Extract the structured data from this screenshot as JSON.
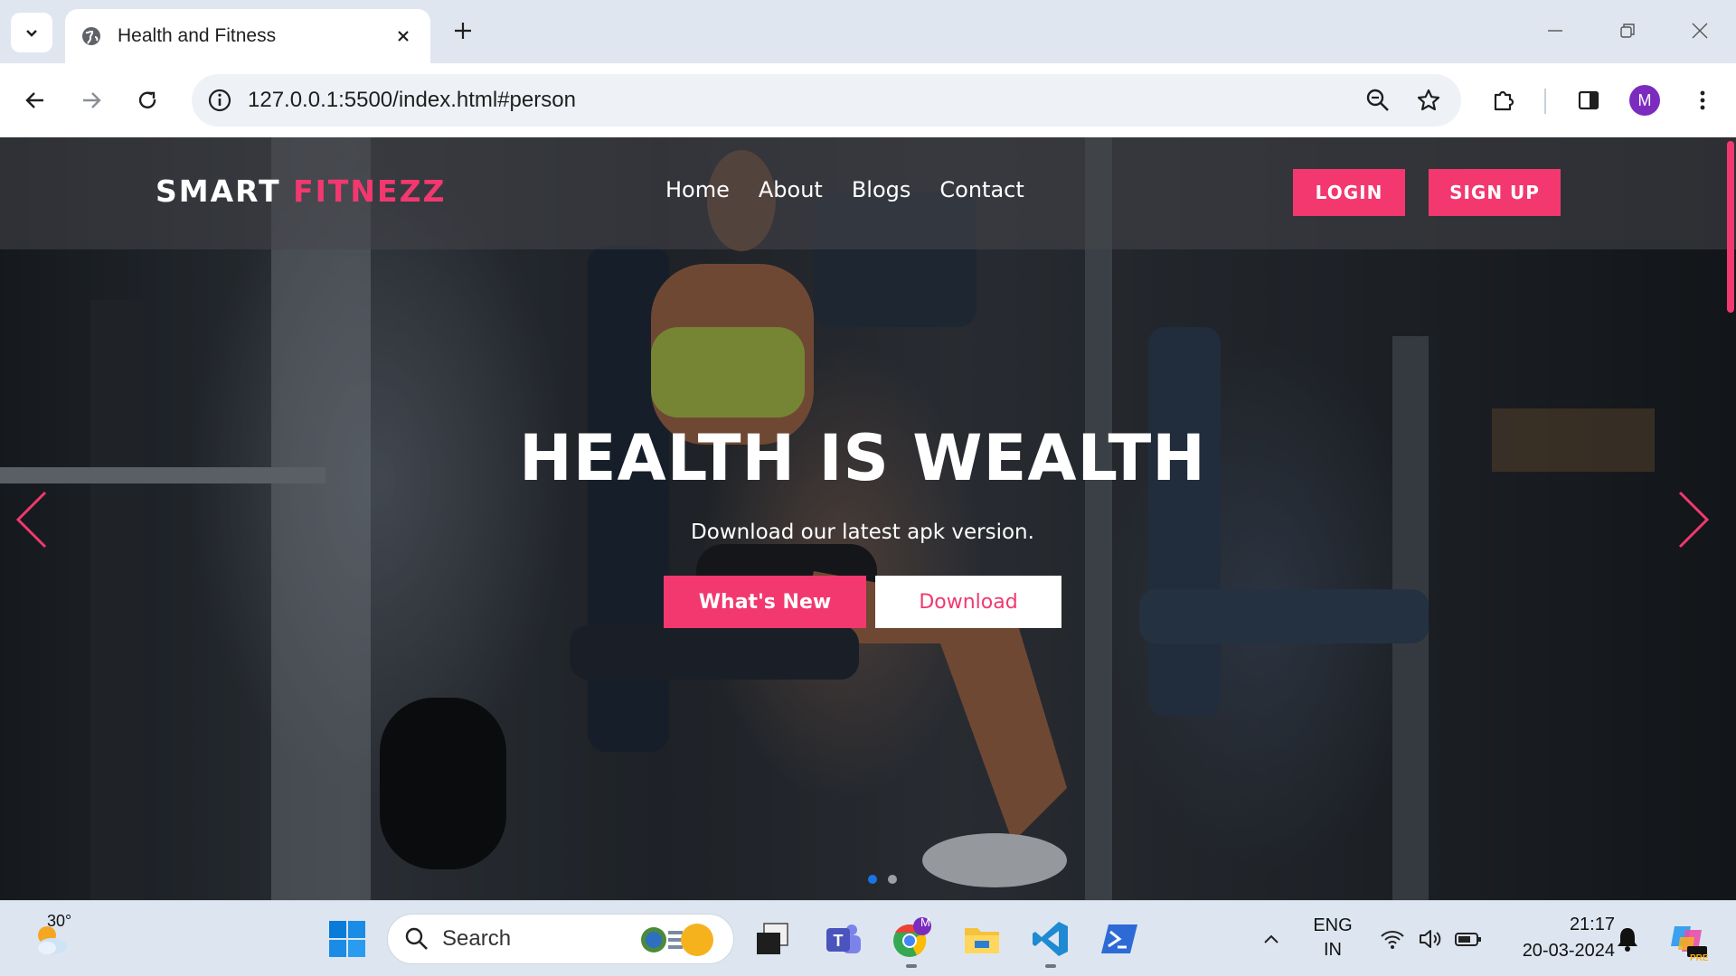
{
  "browser": {
    "tab_title": "Health and Fitness",
    "url": "127.0.0.1:5500/index.html#person",
    "profile_initial": "M"
  },
  "site": {
    "logo_primary": "SMART",
    "logo_accent": "FITNEZZ",
    "nav": [
      "Home",
      "About",
      "Blogs",
      "Contact"
    ],
    "login_label": "LOGIN",
    "signup_label": "SIGN UP",
    "hero_title": "HEALTH IS WEALTH",
    "hero_subtitle": "Download our latest apk version.",
    "cta_whats_new": "What's New",
    "cta_download": "Download",
    "accent_color": "#f2386f"
  },
  "taskbar": {
    "weather_temp": "30°",
    "search_label": "Search",
    "lang_line1": "ENG",
    "lang_line2": "IN",
    "time": "21:17",
    "date": "20-03-2024",
    "chrome_badge": "M",
    "copilot_badge": "PRE"
  }
}
